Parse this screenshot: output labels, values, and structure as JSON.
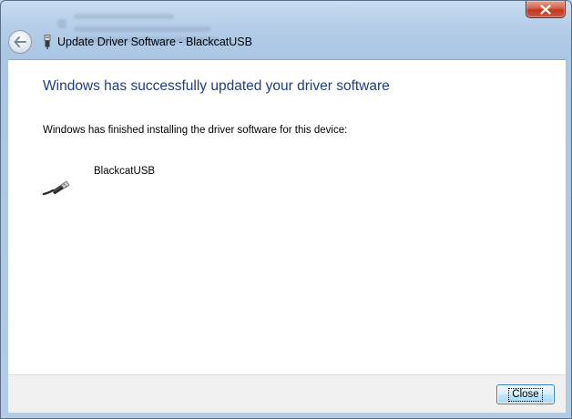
{
  "window": {
    "title": "Update Driver Software - BlackcatUSB",
    "close_icon": "close-x-icon"
  },
  "header": {
    "back_icon": "back-arrow-icon",
    "device_icon": "usb-plug-icon"
  },
  "content": {
    "heading": "Windows has successfully updated your driver software",
    "message": "Windows has finished installing the driver software for this device:",
    "device": {
      "name": "BlackcatUSB",
      "icon": "usb-cable-icon"
    }
  },
  "footer": {
    "close_label": "Close"
  },
  "colors": {
    "heading": "#1e3c87",
    "titlebar_close": "#c1381f",
    "button_border": "#3c7fb1"
  }
}
